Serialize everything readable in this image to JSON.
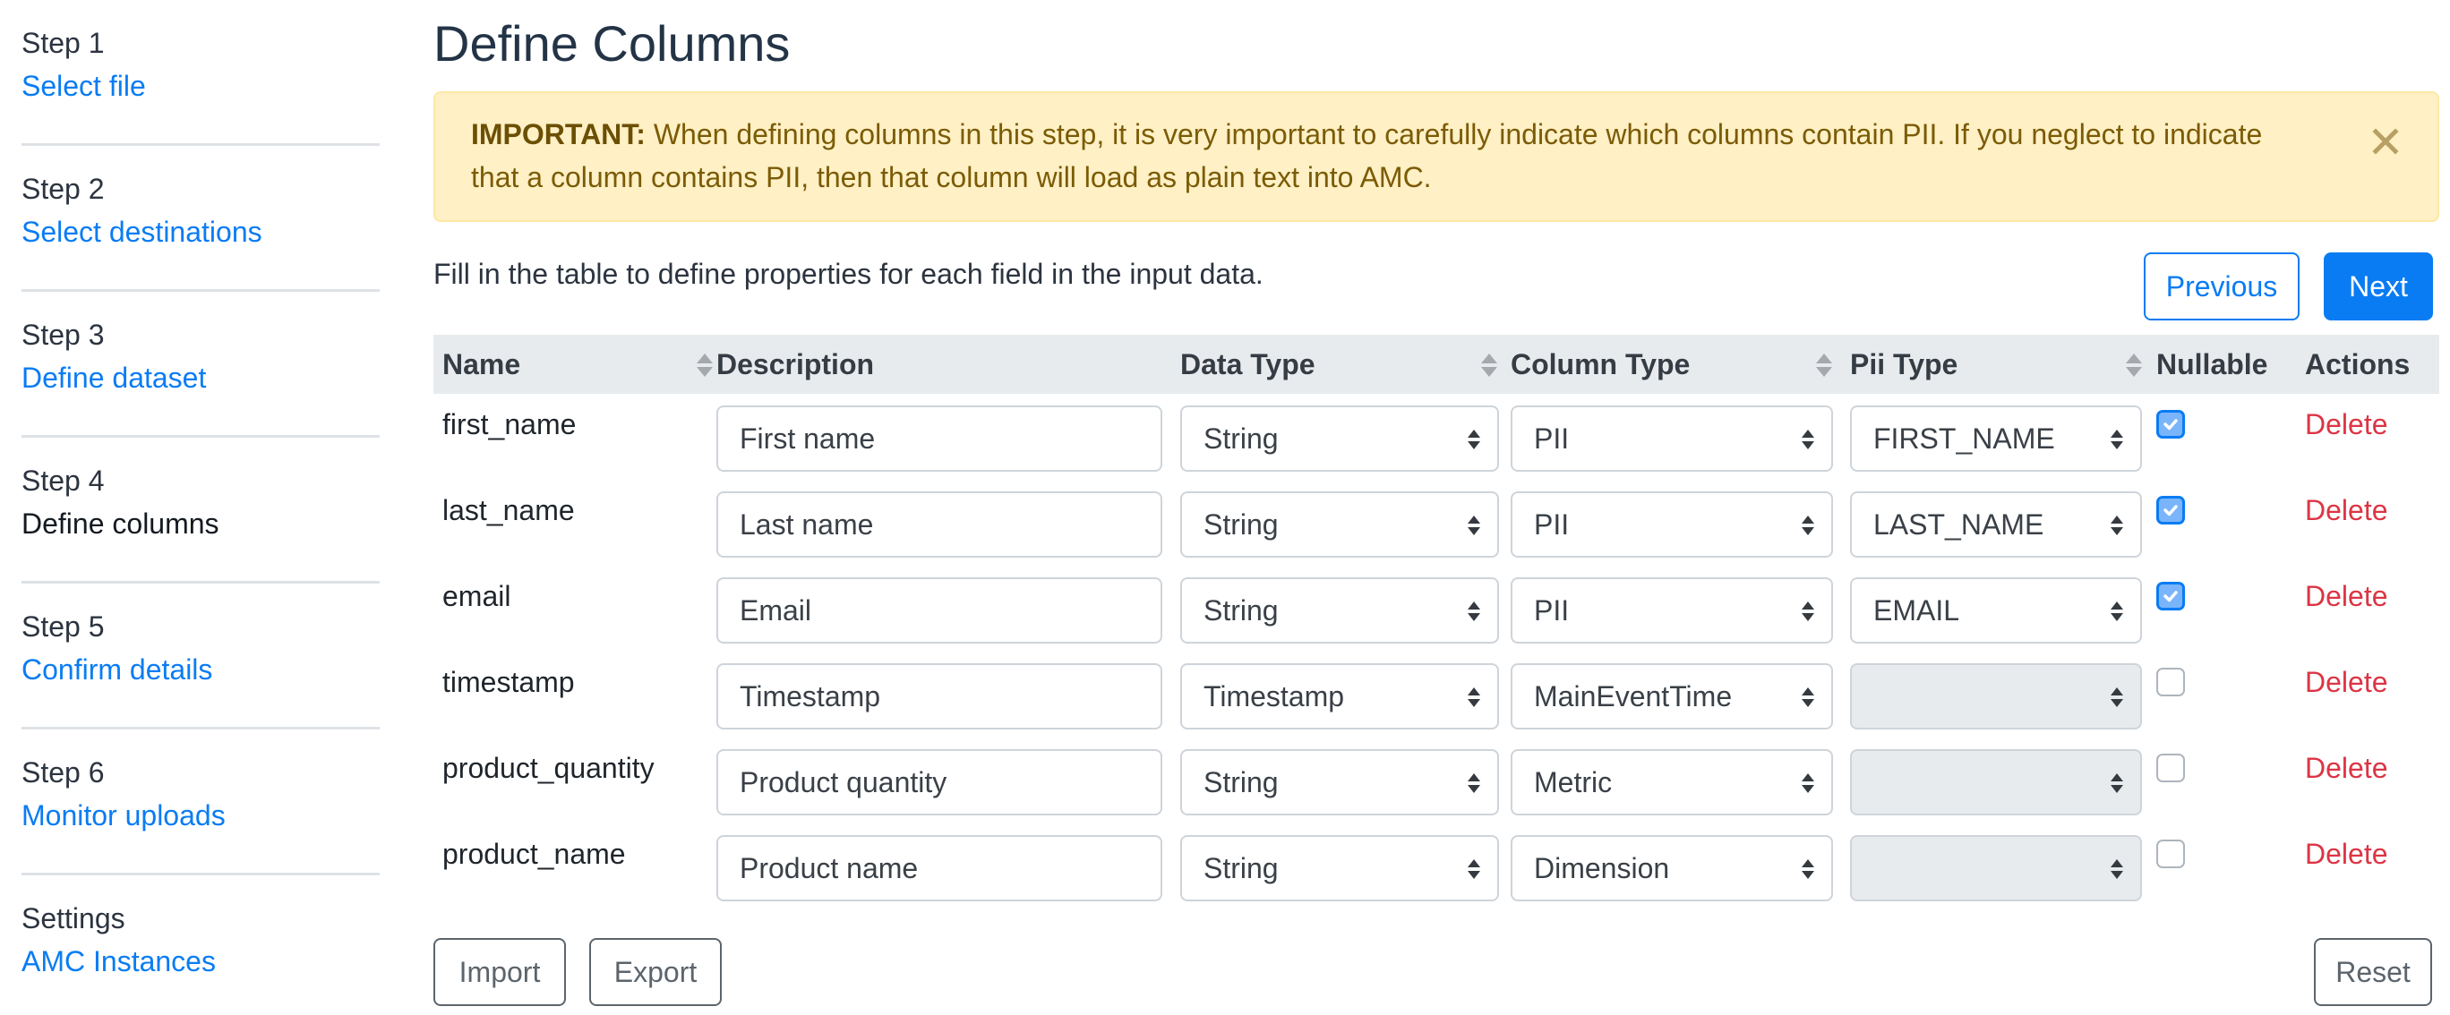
{
  "sidebar": {
    "steps": [
      {
        "label": "Step 1",
        "link": "Select file",
        "current": false
      },
      {
        "label": "Step 2",
        "link": "Select destinations",
        "current": false
      },
      {
        "label": "Step 3",
        "link": "Define dataset",
        "current": false
      },
      {
        "label": "Step 4",
        "link": "Define columns",
        "current": true
      },
      {
        "label": "Step 5",
        "link": "Confirm details",
        "current": false
      },
      {
        "label": "Step 6",
        "link": "Monitor uploads",
        "current": false
      },
      {
        "label": "Settings",
        "link": "AMC Instances",
        "current": false
      }
    ]
  },
  "main": {
    "title": "Define Columns",
    "alert": {
      "strong": "IMPORTANT:",
      "text": " When defining columns in this step, it is very important to carefully indicate which columns contain PII. If you neglect to indicate that a column contains PII, then that column will load as plain text into AMC.",
      "close_icon": "close-icon"
    },
    "intro": "Fill in the table to define properties for each field in the input data.",
    "buttons": {
      "previous": "Previous",
      "next": "Next",
      "import": "Import",
      "export": "Export",
      "reset": "Reset"
    },
    "table": {
      "headers": {
        "name": "Name",
        "description": "Description",
        "data_type": "Data Type",
        "column_type": "Column Type",
        "pii_type": "Pii Type",
        "nullable": "Nullable",
        "actions": "Actions"
      },
      "rows": [
        {
          "name": "first_name",
          "description": "First name",
          "data_type": "String",
          "column_type": "PII",
          "pii_type": "FIRST_NAME",
          "pii_disabled": false,
          "nullable": true,
          "action": "Delete"
        },
        {
          "name": "last_name",
          "description": "Last name",
          "data_type": "String",
          "column_type": "PII",
          "pii_type": "LAST_NAME",
          "pii_disabled": false,
          "nullable": true,
          "action": "Delete"
        },
        {
          "name": "email",
          "description": "Email",
          "data_type": "String",
          "column_type": "PII",
          "pii_type": "EMAIL",
          "pii_disabled": false,
          "nullable": true,
          "action": "Delete"
        },
        {
          "name": "timestamp",
          "description": "Timestamp",
          "data_type": "Timestamp",
          "column_type": "MainEventTime",
          "pii_type": "",
          "pii_disabled": true,
          "nullable": false,
          "action": "Delete"
        },
        {
          "name": "product_quantity",
          "description": "Product quantity",
          "data_type": "String",
          "column_type": "Metric",
          "pii_type": "",
          "pii_disabled": true,
          "nullable": false,
          "action": "Delete"
        },
        {
          "name": "product_name",
          "description": "Product name",
          "data_type": "String",
          "column_type": "Dimension",
          "pii_type": "",
          "pii_disabled": true,
          "nullable": false,
          "action": "Delete"
        }
      ]
    }
  },
  "colors": {
    "link": "#0a7cf3",
    "primary": "#0a7cf3",
    "danger": "#dc3545",
    "alert_bg": "#fff0c5",
    "alert_text": "#7b5b06",
    "header_bg": "#e8ebee"
  }
}
